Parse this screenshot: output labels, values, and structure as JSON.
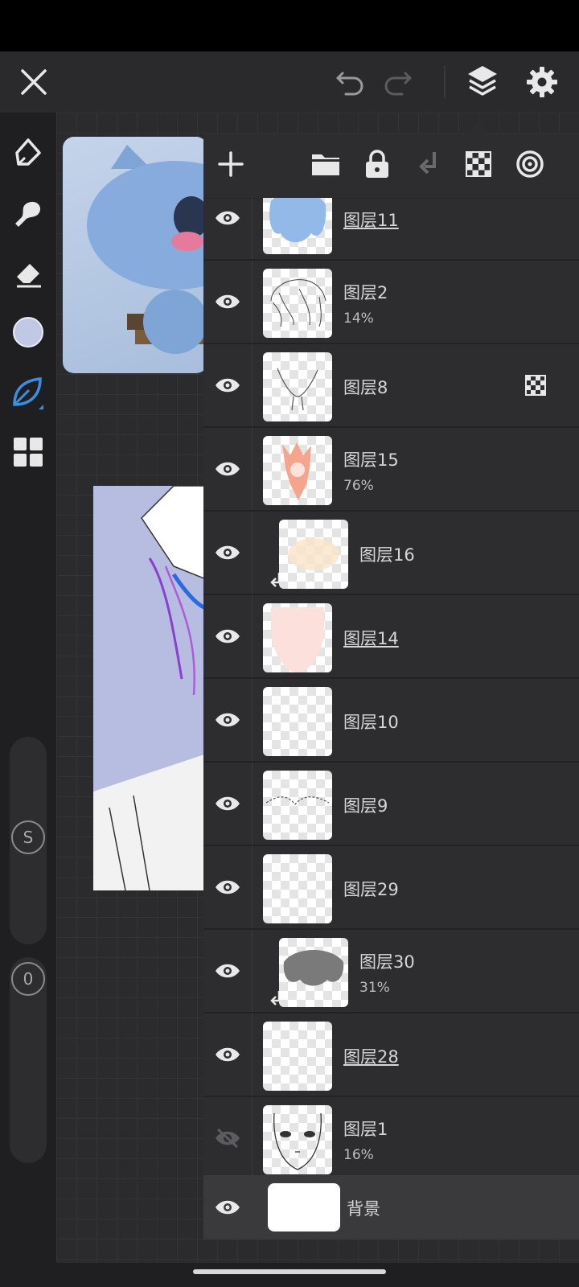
{
  "toolbar": {
    "icons": [
      "close-icon",
      "undo-icon",
      "redo-icon",
      "layers-icon",
      "settings-icon"
    ]
  },
  "tools": {
    "icons": [
      "pen-icon",
      "brush-icon",
      "eraser-icon",
      "color-swatch",
      "leaf-brush-icon",
      "grid-menu-icon"
    ],
    "brush_color": "#c0c8e6",
    "active_color": "#3a8fe0"
  },
  "sliders": {
    "size_label": "S",
    "opacity_label": "0"
  },
  "layer_panel": {
    "toolbar_icons": [
      "add-icon",
      "folder-icon",
      "lock-icon",
      "merge-down-icon",
      "checker-icon",
      "blend-icon"
    ],
    "layers": [
      {
        "name": "图层11",
        "opacity": "",
        "visible": true,
        "clipped": false,
        "selected": true
      },
      {
        "name": "图层2",
        "opacity": "14%",
        "visible": true,
        "clipped": false,
        "selected": false
      },
      {
        "name": "图层8",
        "opacity": "",
        "visible": true,
        "clipped": false,
        "selected": false,
        "alpha_lock": true
      },
      {
        "name": "图层15",
        "opacity": "76%",
        "visible": true,
        "clipped": false,
        "selected": false
      },
      {
        "name": "图层16",
        "opacity": "",
        "visible": true,
        "clipped": true,
        "selected": false
      },
      {
        "name": "图层14",
        "opacity": "",
        "visible": true,
        "clipped": false,
        "selected": true
      },
      {
        "name": "图层10",
        "opacity": "",
        "visible": true,
        "clipped": false,
        "selected": false
      },
      {
        "name": "图层9",
        "opacity": "",
        "visible": true,
        "clipped": false,
        "selected": false
      },
      {
        "name": "图层29",
        "opacity": "",
        "visible": true,
        "clipped": false,
        "selected": false
      },
      {
        "name": "图层30",
        "opacity": "31%",
        "visible": true,
        "clipped": true,
        "selected": false
      },
      {
        "name": "图层28",
        "opacity": "",
        "visible": true,
        "clipped": false,
        "selected": true
      },
      {
        "name": "图层1",
        "opacity": "16%",
        "visible": false,
        "clipped": false,
        "selected": false
      }
    ],
    "background": {
      "name": "背景",
      "visible": true
    }
  }
}
